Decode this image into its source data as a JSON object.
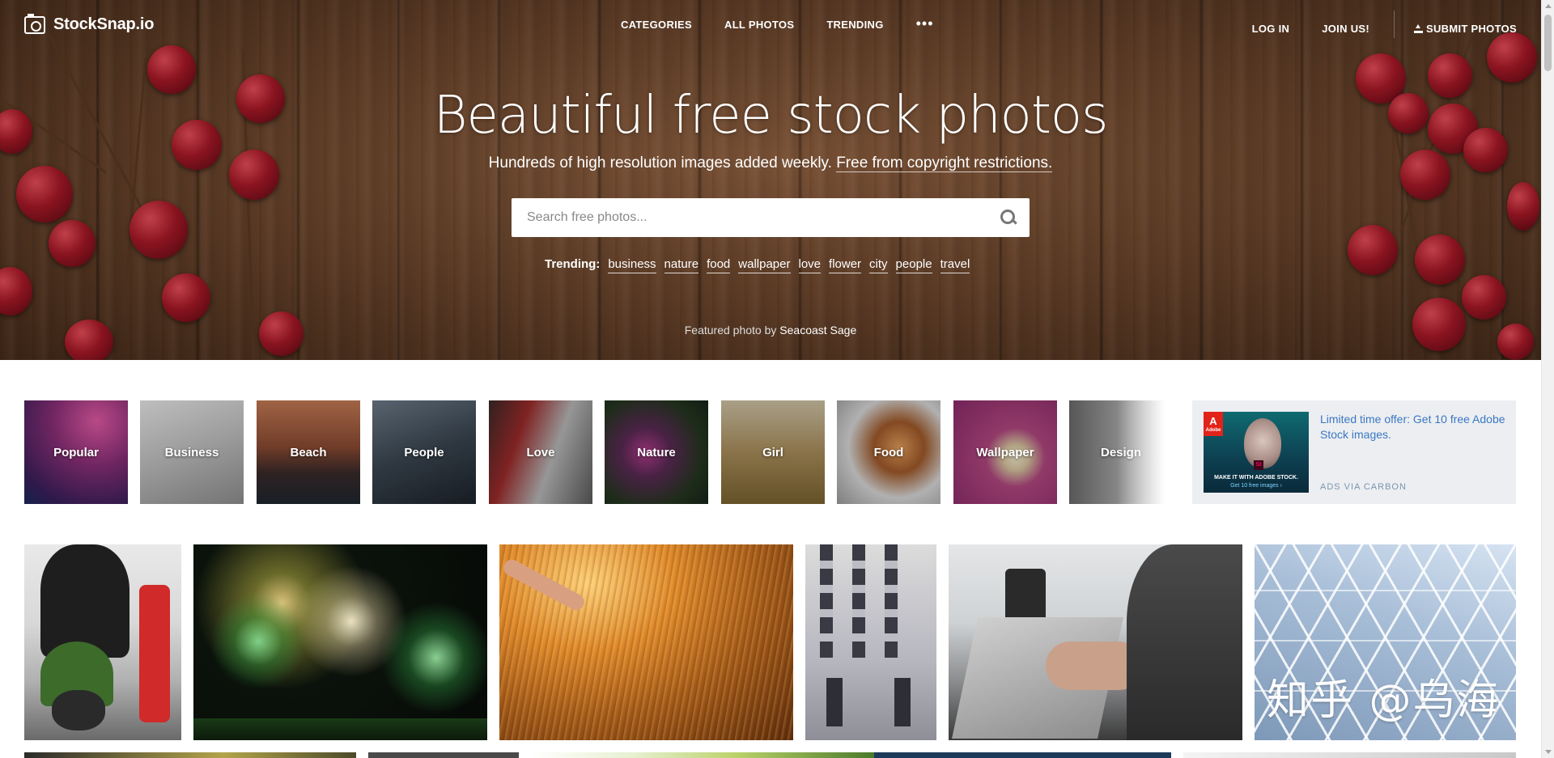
{
  "nav": {
    "logo_text": "StockSnap.io",
    "links": [
      "CATEGORIES",
      "ALL PHOTOS",
      "TRENDING"
    ],
    "more": "•••",
    "login": "LOG IN",
    "join": "JOIN US!",
    "submit": "SUBMIT PHOTOS"
  },
  "hero": {
    "title": "Beautiful free stock photos",
    "subtitle_plain": "Hundreds of high resolution images added weekly. ",
    "subtitle_link": "Free from copyright restrictions.",
    "search_placeholder": "Search free photos...",
    "trending_label": "Trending:",
    "trending_tags": [
      "business",
      "nature",
      "food",
      "wallpaper",
      "love",
      "flower",
      "city",
      "people",
      "travel"
    ],
    "featured_prefix": "Featured photo by ",
    "featured_author": "Seacoast Sage"
  },
  "categories": [
    {
      "label": "Popular"
    },
    {
      "label": "Business"
    },
    {
      "label": "Beach"
    },
    {
      "label": "People"
    },
    {
      "label": "Love"
    },
    {
      "label": "Nature"
    },
    {
      "label": "Girl"
    },
    {
      "label": "Food"
    },
    {
      "label": "Wallpaper"
    },
    {
      "label": "Design"
    }
  ],
  "ad": {
    "text": "Limited time offer: Get 10 free Adobe Stock images.",
    "via": "ADS VIA CARBON",
    "image_brand": "Adobe",
    "image_st": "St",
    "image_line1": "MAKE IT WITH ADOBE STOCK.",
    "image_line2": "Get 10 free images ›"
  },
  "watermark": "知乎 @乌海"
}
